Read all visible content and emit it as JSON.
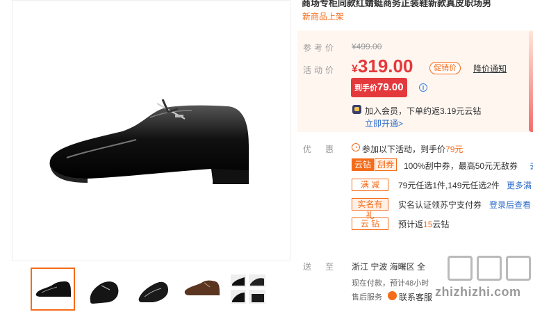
{
  "product": {
    "title": "商场专柜同款红蜻蜓商务正装鞋新款真皮职场男",
    "new_tag": "新商品上架"
  },
  "price": {
    "ref_label": "参考价",
    "ref_value": "¥499.00",
    "current_label": "活动价",
    "currency": "¥",
    "current_value": "319.00",
    "promo_badge": "促销价",
    "drop_notice": "降价通知",
    "final_label": "到手价",
    "final_value": "79.00",
    "info_icon": "i",
    "member_text": "加入会员，下单约返3.19元云钻",
    "member_link": "立即开通>"
  },
  "promotions": {
    "label": "优惠",
    "intro_prefix": "参加以下活动，到手价",
    "intro_value": "79元",
    "items": [
      {
        "tag1": "云钻",
        "tag2": "刮券",
        "text": "100%刮中券，最高50元无敌券",
        "link": "去"
      },
      {
        "tag": "满 减",
        "text": "79元任选1件,149元任选2件",
        "link": "更多满"
      },
      {
        "tag": "实名有礼",
        "text": "实名认证领苏宁支付券",
        "link": "登录后查看"
      },
      {
        "tag": "云 钻",
        "text_prefix": "预计返",
        "text_value": "15",
        "text_suffix": "云钻"
      }
    ]
  },
  "shipping": {
    "label": "送至",
    "location": "浙江  宁波  海曙区  全",
    "payment_note": "现在付款，预计48小时",
    "service_label": "售后服务",
    "cs_text": "联系客服"
  },
  "watermark": {
    "text": "zhizhizhi.com"
  },
  "thumbnails": [
    {
      "name": "thumb-1",
      "active": true
    },
    {
      "name": "thumb-2",
      "active": false
    },
    {
      "name": "thumb-3",
      "active": false
    },
    {
      "name": "thumb-4",
      "active": false
    },
    {
      "name": "thumb-5",
      "active": false
    }
  ],
  "colors": {
    "accent": "#f46b19",
    "price_red": "#e4393c",
    "link_blue": "#2c6bc7",
    "panel_bg": "#fff6f0"
  }
}
